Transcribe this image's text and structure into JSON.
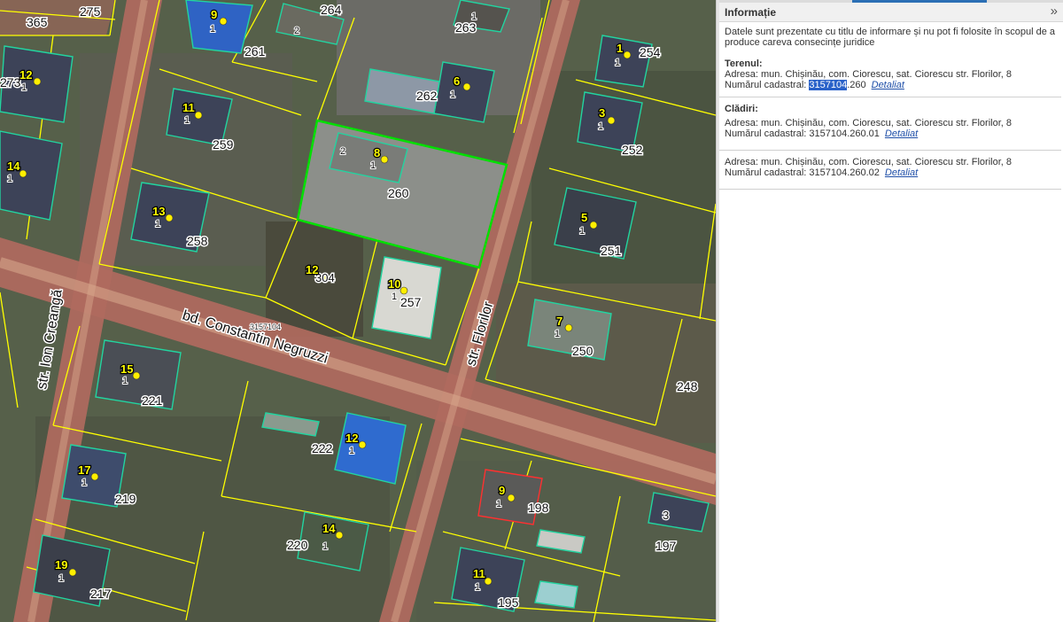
{
  "panel": {
    "title": "Informație",
    "collapse_icon": "»",
    "disclaimer": "Datele sunt prezentate cu titlu de informare și nu pot fi folosite în scopul de a produce careva consecințe juridice",
    "teren": {
      "heading": "Terenul:",
      "address": "Adresa: mun. Chișinău, com. Ciorescu, sat. Ciorescu str. Florilor, 8",
      "cad_label": "Numărul cadastral: ",
      "cad_highlight": "3157104",
      "cad_rest": ".260",
      "link": "Detaliat"
    },
    "cladiri": {
      "heading": "Clădiri:",
      "items": [
        {
          "address": "Adresa: mun. Chișinău, com. Ciorescu, sat. Ciorescu str. Florilor, 8",
          "cad": "Numărul cadastral: 3157104.260.01",
          "link": "Detaliat"
        },
        {
          "address": "Adresa: mun. Chișinău, com. Ciorescu, sat. Ciorescu str. Florilor, 8",
          "cad": "Numărul cadastral: 3157104.260.02",
          "link": "Detaliat"
        }
      ]
    }
  },
  "map": {
    "streets": {
      "creanga": "str. Ion Creangă",
      "negruzzi": "bd. Constantin Negruzzi",
      "florilor": "str. Florilor",
      "sector": "3157104"
    },
    "parcels": [
      "275",
      "365",
      "264",
      "263",
      "261",
      "254",
      "273",
      "262",
      "259",
      "252",
      "260",
      "258",
      "251",
      "304",
      "257",
      "250",
      "248",
      "221",
      "222",
      "219",
      "198",
      "220",
      "197",
      "217",
      "195"
    ],
    "houses": [
      "9",
      "1",
      "12",
      "6",
      "11",
      "3",
      "14",
      "8",
      "13",
      "5",
      "12",
      "10",
      "7",
      "15",
      "12",
      "17",
      "9",
      "3",
      "14",
      "19",
      "11"
    ],
    "sublabels": [
      "1",
      "2"
    ],
    "colors": {
      "road": "#b06a5e",
      "parcel": "#ffff00",
      "building": "#22d4a0",
      "selected": "#00e000",
      "point": "#ffff00"
    }
  }
}
